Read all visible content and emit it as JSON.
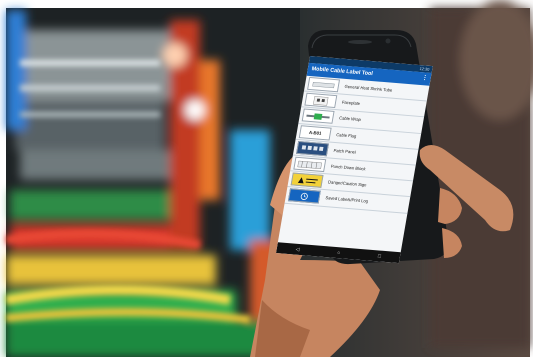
{
  "app": {
    "title": "Mobile Cable Label Tool",
    "status_time": "12:30",
    "menu_glyph": "⋮"
  },
  "menu_items": [
    {
      "label": "General Heat Shrink Tube",
      "icon": "heat-shrink-tube-icon",
      "thumb_text": ""
    },
    {
      "label": "Faceplate",
      "icon": "faceplate-icon",
      "thumb_text": ""
    },
    {
      "label": "Cable Wrap",
      "icon": "cable-wrap-icon",
      "thumb_text": ""
    },
    {
      "label": "Cable Flag",
      "icon": "cable-flag-icon",
      "thumb_text": "A-B01"
    },
    {
      "label": "Patch Panel",
      "icon": "patch-panel-icon",
      "thumb_text": ""
    },
    {
      "label": "Punch Down Block",
      "icon": "punch-down-block-icon",
      "thumb_text": ""
    },
    {
      "label": "Danger/Caution Sign",
      "icon": "warning-sign-icon",
      "thumb_text": ""
    },
    {
      "label": "Saved Labels/Print Log",
      "icon": "saved-labels-icon",
      "thumb_text": ""
    }
  ],
  "nav": {
    "back": "◁",
    "home": "○",
    "recents": "□"
  },
  "colors": {
    "app_bar": "#1565c0",
    "status_bar": "#0d3a66",
    "cable_green": "#2fae4e",
    "cable_red": "#d8392b",
    "cable_yellow": "#e8c23a",
    "cable_orange": "#e8772b",
    "cable_blue": "#2f7fd6"
  }
}
